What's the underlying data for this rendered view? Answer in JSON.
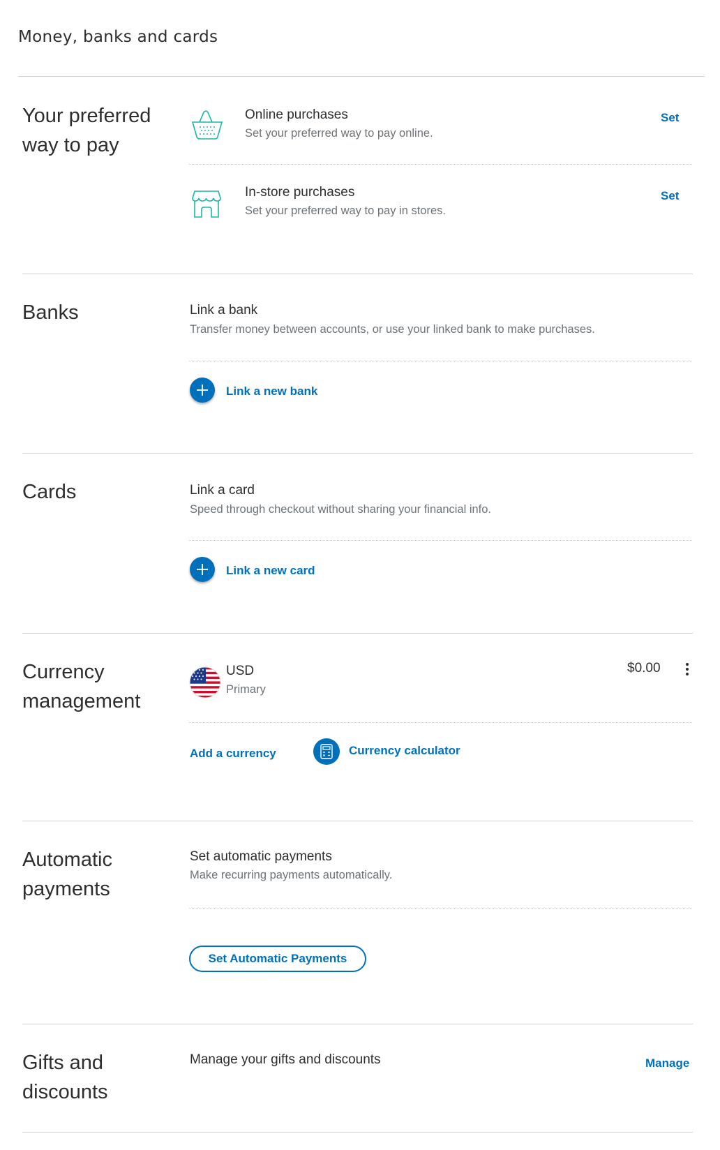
{
  "page": {
    "title": "Money, banks and cards"
  },
  "preferred": {
    "title": "Your preferred way to pay",
    "online": {
      "icon": "shopping-basket-icon",
      "title": "Online purchases",
      "desc": "Set your preferred way to pay online.",
      "action": "Set"
    },
    "instore": {
      "icon": "storefront-icon",
      "title": "In-store purchases",
      "desc": "Set your preferred way to pay in stores.",
      "action": "Set"
    }
  },
  "banks": {
    "title": "Banks",
    "link_title": "Link a bank",
    "link_desc": "Transfer money between accounts, or use your linked bank to make purchases.",
    "action": "Link a new bank",
    "action_icon": "plus-icon"
  },
  "cards": {
    "title": "Cards",
    "link_title": "Link a card",
    "link_desc": "Speed through checkout without sharing your financial info.",
    "action": "Link a new card",
    "action_icon": "plus-icon"
  },
  "currency": {
    "title": "Currency management",
    "code": "USD",
    "label": "Primary",
    "balance": "$0.00",
    "flag_icon": "us-flag-icon",
    "add_action": "Add a currency",
    "calculator_action": "Currency calculator",
    "calculator_icon": "calculator-icon"
  },
  "automatic": {
    "title": "Automatic payments",
    "item_title": "Set automatic payments",
    "item_desc": "Make recurring payments automatically.",
    "button": "Set Automatic Payments"
  },
  "gifts": {
    "title": "Gifts and discounts",
    "item_title": "Manage your gifts and discounts",
    "action": "Manage"
  },
  "colors": {
    "accent": "#0070ba",
    "icon_teal": "#1ab7a8",
    "text": "#2c2e2f",
    "muted": "#6c7378"
  }
}
